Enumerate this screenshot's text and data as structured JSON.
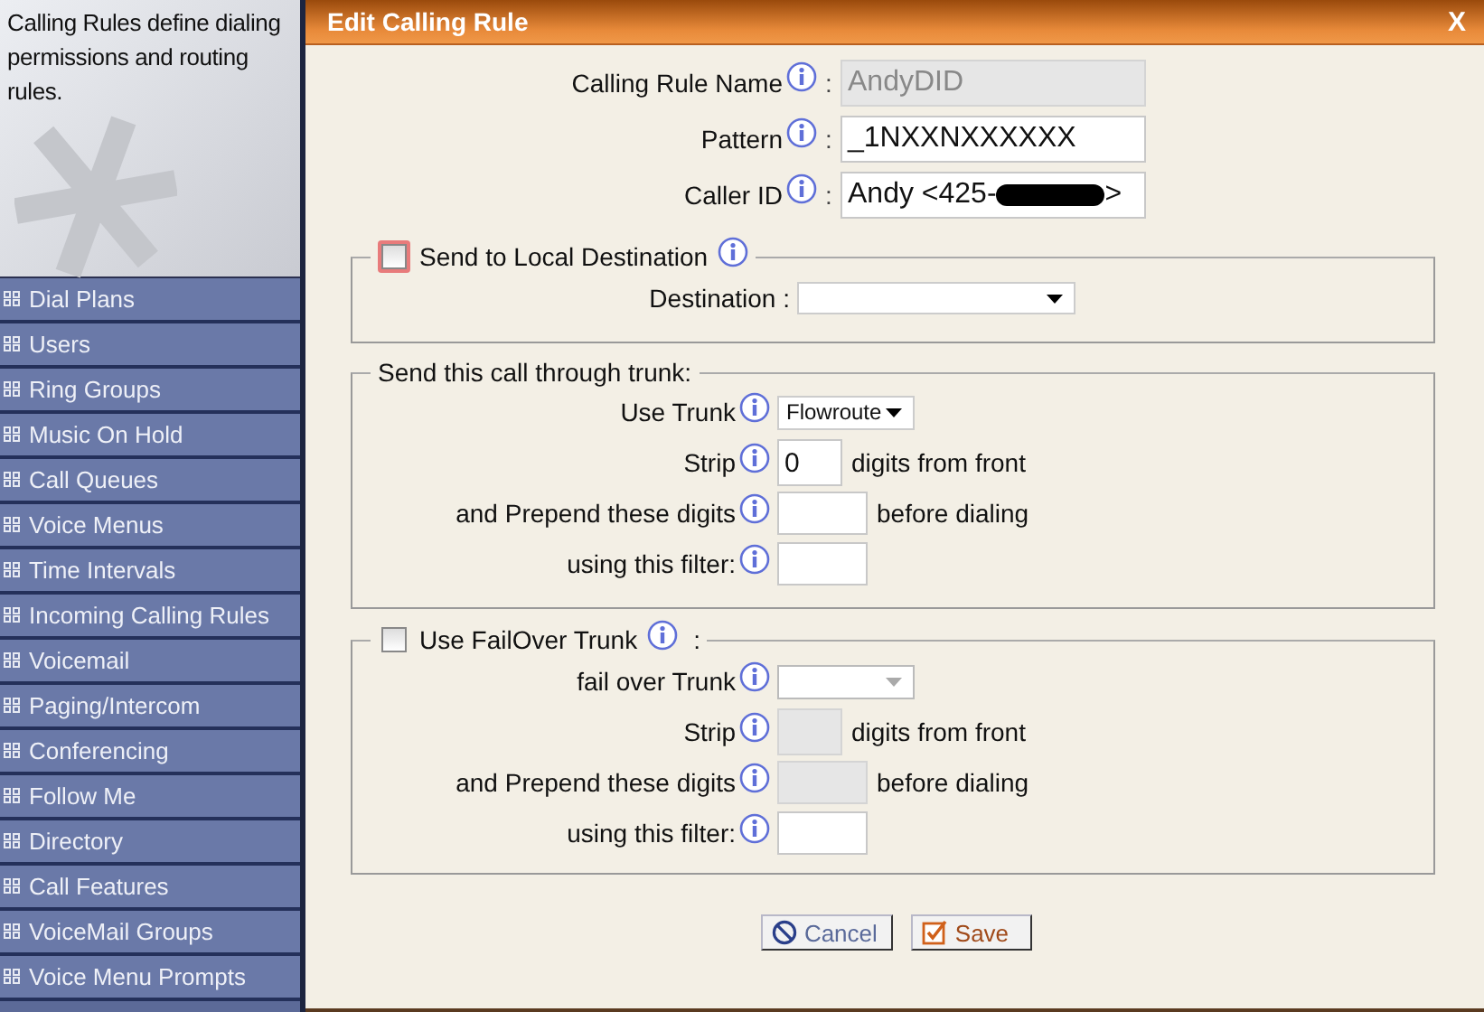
{
  "sidebar": {
    "description": "Calling Rules define dialing permissions and routing rules.",
    "items": [
      {
        "label": "Dial Plans"
      },
      {
        "label": "Users"
      },
      {
        "label": "Ring Groups"
      },
      {
        "label": "Music On Hold"
      },
      {
        "label": "Call Queues"
      },
      {
        "label": "Voice Menus"
      },
      {
        "label": "Time Intervals"
      },
      {
        "label": "Incoming Calling Rules"
      },
      {
        "label": "Voicemail"
      },
      {
        "label": "Paging/Intercom"
      },
      {
        "label": "Conferencing"
      },
      {
        "label": "Follow Me"
      },
      {
        "label": "Directory"
      },
      {
        "label": "Call Features"
      },
      {
        "label": "VoiceMail Groups"
      },
      {
        "label": "Voice Menu Prompts"
      }
    ]
  },
  "dialog": {
    "title": "Edit Calling Rule",
    "close": "X",
    "fields": [
      {
        "label": "Calling Rule Name",
        "colon": ":",
        "value": "AndyDID",
        "disabled": true
      },
      {
        "label": "Pattern",
        "colon": ":",
        "value": "_1NXXNXXXXXX",
        "disabled": false
      },
      {
        "label": "Caller ID",
        "colon": ":",
        "value": "Andy <425-",
        "value_end": ">",
        "disabled": false,
        "redacted": true
      }
    ],
    "local_destination": {
      "label": "Send to Local Destination",
      "checked": false,
      "focused": true,
      "destination_label": "Destination :"
    },
    "trunk_section": {
      "legend": "Send this call through trunk:",
      "rows": [
        {
          "kind": "select",
          "label": "Use Trunk",
          "value": "Flowroute",
          "disabled": false
        },
        {
          "kind": "number",
          "label": "Strip",
          "value": "0",
          "suffix": "digits from front",
          "disabled": false
        },
        {
          "kind": "text",
          "label": "and Prepend these digits",
          "suffix": "before dialing",
          "disabled": false
        },
        {
          "kind": "text",
          "label": "using this filter:",
          "disabled": false
        }
      ]
    },
    "failover_section": {
      "label": "Use FailOver Trunk",
      "checked": false,
      "colon": ":",
      "rows": [
        {
          "kind": "select",
          "label": "fail over Trunk",
          "disabled": true
        },
        {
          "kind": "number",
          "label": "Strip",
          "suffix": "digits from front",
          "disabled": true
        },
        {
          "kind": "text",
          "label": "and Prepend these digits",
          "suffix": "before dialing",
          "disabled": true
        },
        {
          "kind": "text",
          "label": "using this filter:",
          "disabled": false
        }
      ]
    },
    "buttons": [
      {
        "label": "Cancel",
        "kind": "cancel"
      },
      {
        "label": "Save",
        "kind": "save"
      }
    ]
  }
}
